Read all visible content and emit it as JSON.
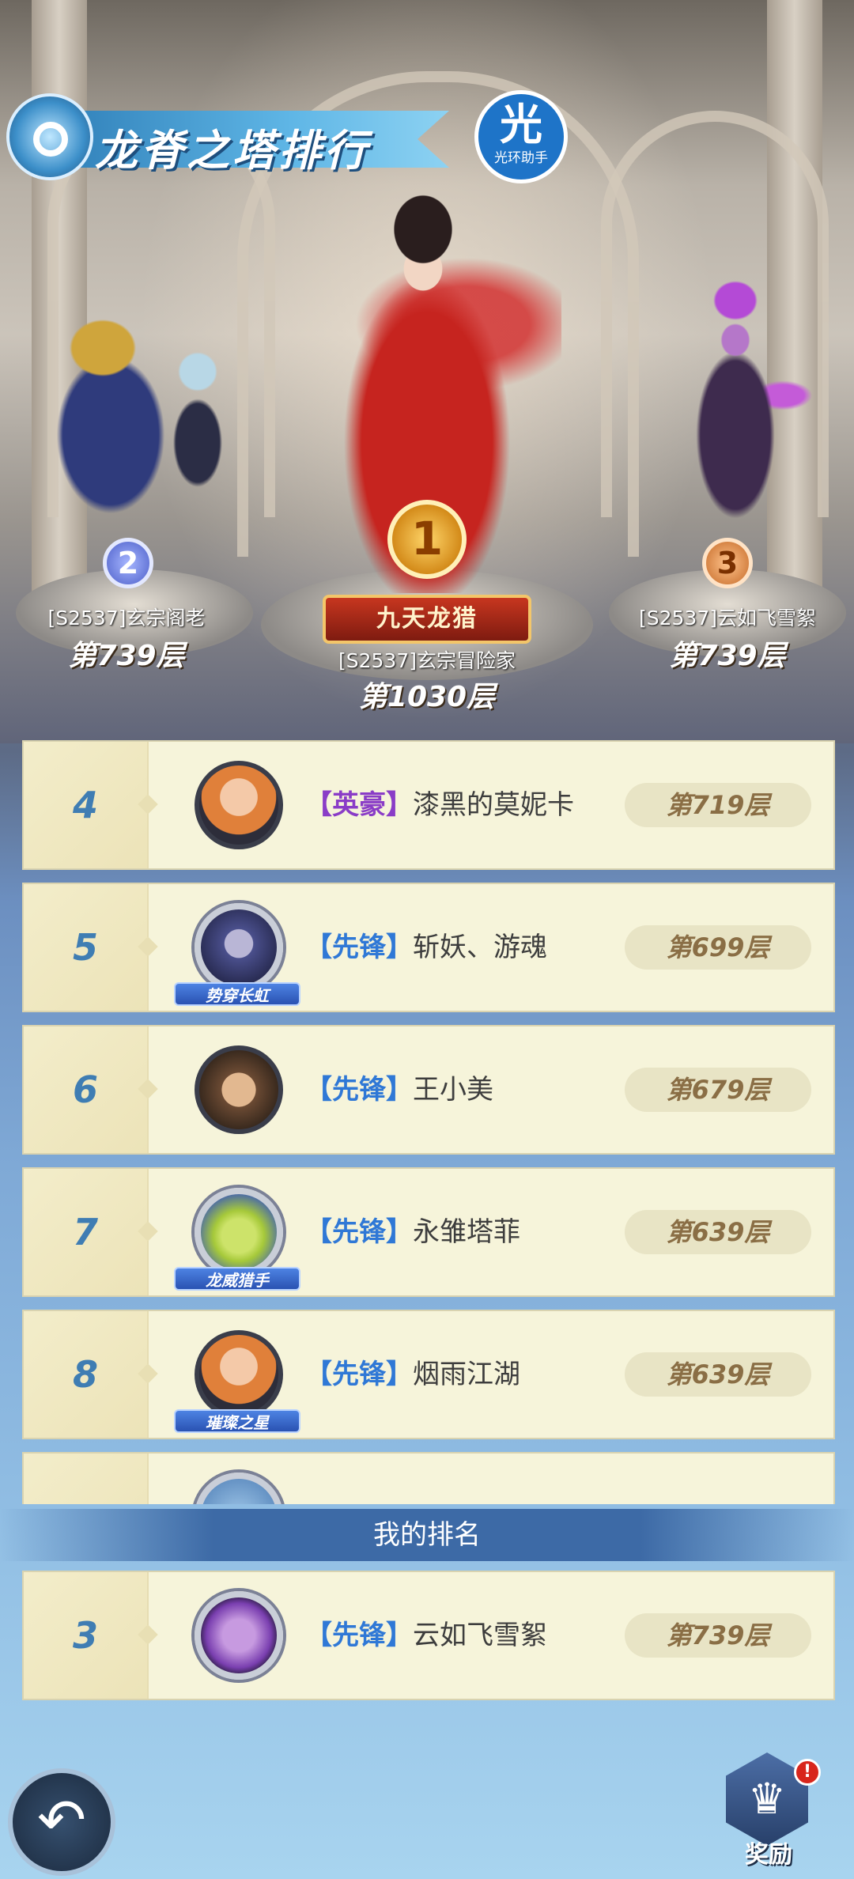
{
  "header": {
    "title": "龙脊之塔排行",
    "helper_main": "光",
    "helper_sub": "光环助手"
  },
  "podium": {
    "first": {
      "medal": "1",
      "title": "九天龙猎",
      "name": "[S2537]玄宗冒险家",
      "floor": "第1030层"
    },
    "second": {
      "medal": "2",
      "name": "[S2537]玄宗阁老",
      "floor": "第739层"
    },
    "third": {
      "medal": "3",
      "name": "[S2537]云如飞雪絮",
      "floor": "第739层"
    }
  },
  "rankings": [
    {
      "rank": "4",
      "guild": "【英豪】",
      "guild_color": "#8a3cc7",
      "name": "漆黑的莫妮卡",
      "floor": "第719层",
      "badge": "",
      "avatar_color": "#e0803a"
    },
    {
      "rank": "5",
      "guild": "【先锋】",
      "guild_color": "#2f78d6",
      "name": "斩妖、游魂",
      "floor": "第699层",
      "badge": "势穿长虹",
      "avatar_color": "#4a4f8c"
    },
    {
      "rank": "6",
      "guild": "【先锋】",
      "guild_color": "#2f78d6",
      "name": "王小美",
      "floor": "第679层",
      "badge": "",
      "avatar_color": "#6b4a33"
    },
    {
      "rank": "7",
      "guild": "【先锋】",
      "guild_color": "#2f78d6",
      "name": "永雏塔菲",
      "floor": "第639层",
      "badge": "龙威猎手",
      "avatar_color": "#a6c93a"
    },
    {
      "rank": "8",
      "guild": "【先锋】",
      "guild_color": "#2f78d6",
      "name": "烟雨江湖",
      "floor": "第639层",
      "badge": "璀璨之星",
      "avatar_color": "#e0803a"
    }
  ],
  "my_rank": {
    "header": "我的排名",
    "rank": "3",
    "guild": "【先锋】",
    "name": "云如飞雪絮",
    "floor": "第739层"
  },
  "footer": {
    "back_icon": "back-arrow-icon",
    "reward_label": "奖励",
    "reward_alert": "!"
  }
}
